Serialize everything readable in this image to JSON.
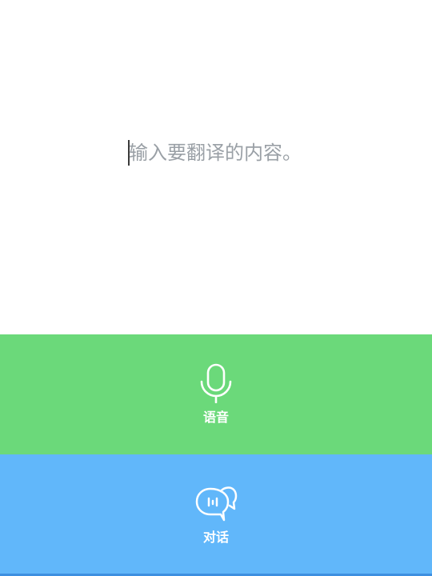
{
  "input": {
    "placeholder": "输入要翻译的内容。"
  },
  "voice": {
    "label": "语音",
    "icon": "microphone-icon",
    "color": "#6BD97A"
  },
  "chat": {
    "label": "对话",
    "icon": "conversation-icon",
    "color": "#61B7FA"
  }
}
